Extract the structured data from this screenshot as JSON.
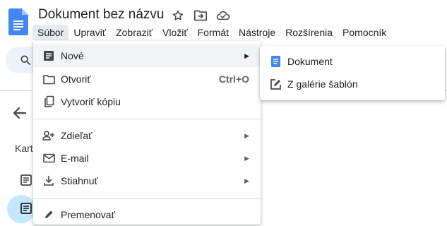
{
  "header": {
    "title": "Dokument bez názvu",
    "icons": [
      "star-icon",
      "move-to-folder-icon",
      "cloud-saved-icon"
    ]
  },
  "menubar": {
    "items": [
      "Súbor",
      "Upraviť",
      "Zobraziť",
      "Vložiť",
      "Formát",
      "Nástroje",
      "Rozšírenia",
      "Pomocník"
    ],
    "active": "Súbor"
  },
  "sidebar": {
    "label": "Kart"
  },
  "file_menu": {
    "items": [
      {
        "label": "Nové",
        "icon": "new-doc-icon",
        "submenu": true,
        "highlighted": true
      },
      {
        "label": "Otvoriť",
        "icon": "folder-open-icon",
        "shortcut": "Ctrl+O"
      },
      {
        "label": "Vytvoriť kópiu",
        "icon": "copy-icon"
      },
      {
        "label": "Zdieľať",
        "icon": "person-add-icon",
        "submenu": true
      },
      {
        "label": "E-mail",
        "icon": "email-icon",
        "submenu": true
      },
      {
        "label": "Stiahnuť",
        "icon": "download-icon",
        "submenu": true
      },
      {
        "label": "Premenovať",
        "icon": "rename-icon"
      }
    ]
  },
  "new_submenu": {
    "items": [
      {
        "label": "Dokument",
        "icon": "docs-blue-icon"
      },
      {
        "label": "Z galérie šablón",
        "icon": "template-icon"
      }
    ]
  },
  "colors": {
    "docs_blue": "#4285f4",
    "menu_highlight": "#f1f3f4",
    "menubar_active": "#e8eaed",
    "sidebar_selected": "#c2e7ff",
    "search_bg": "#edf2fa"
  }
}
